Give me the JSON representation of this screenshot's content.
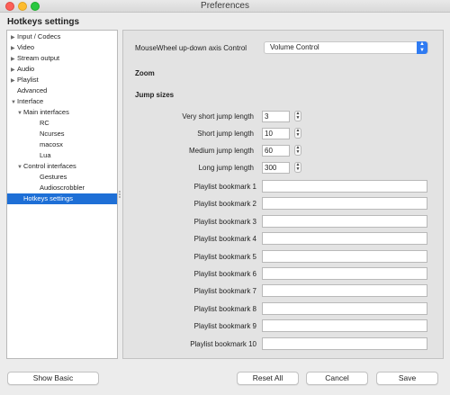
{
  "window": {
    "title": "Preferences"
  },
  "panel_heading": "Hotkeys settings",
  "tree": [
    {
      "label": "Input / Codecs",
      "arrow": "▶",
      "depth": 0,
      "selected": false
    },
    {
      "label": "Video",
      "arrow": "▶",
      "depth": 0,
      "selected": false
    },
    {
      "label": "Stream output",
      "arrow": "▶",
      "depth": 0,
      "selected": false
    },
    {
      "label": "Audio",
      "arrow": "▶",
      "depth": 0,
      "selected": false
    },
    {
      "label": "Playlist",
      "arrow": "▶",
      "depth": 0,
      "selected": false
    },
    {
      "label": "Advanced",
      "arrow": "",
      "depth": 0,
      "selected": false
    },
    {
      "label": "Interface",
      "arrow": "▼",
      "depth": 0,
      "selected": false
    },
    {
      "label": "Main interfaces",
      "arrow": "▼",
      "depth": 1,
      "selected": false
    },
    {
      "label": "RC",
      "arrow": "",
      "depth": 2,
      "selected": false
    },
    {
      "label": "Ncurses",
      "arrow": "",
      "depth": 2,
      "selected": false
    },
    {
      "label": "macosx",
      "arrow": "",
      "depth": 2,
      "selected": false
    },
    {
      "label": "Lua",
      "arrow": "",
      "depth": 2,
      "selected": false
    },
    {
      "label": "Control interfaces",
      "arrow": "▼",
      "depth": 1,
      "selected": false
    },
    {
      "label": "Gestures",
      "arrow": "",
      "depth": 2,
      "selected": false
    },
    {
      "label": "Audioscrobbler",
      "arrow": "",
      "depth": 2,
      "selected": false
    },
    {
      "label": "Hotkeys settings",
      "arrow": "",
      "depth": 1,
      "selected": true
    }
  ],
  "mousewheel": {
    "label": "MouseWheel up-down axis Control",
    "value": "Volume Control"
  },
  "sections": {
    "zoom": "Zoom",
    "jump_sizes": "Jump sizes"
  },
  "jumps": [
    {
      "label": "Very short jump length",
      "value": "3"
    },
    {
      "label": "Short jump length",
      "value": "10"
    },
    {
      "label": "Medium jump length",
      "value": "60"
    },
    {
      "label": "Long jump length",
      "value": "300"
    }
  ],
  "bookmarks": [
    {
      "label": "Playlist bookmark 1",
      "value": ""
    },
    {
      "label": "Playlist bookmark 2",
      "value": ""
    },
    {
      "label": "Playlist bookmark 3",
      "value": ""
    },
    {
      "label": "Playlist bookmark 4",
      "value": ""
    },
    {
      "label": "Playlist bookmark 5",
      "value": ""
    },
    {
      "label": "Playlist bookmark 6",
      "value": ""
    },
    {
      "label": "Playlist bookmark 7",
      "value": ""
    },
    {
      "label": "Playlist bookmark 8",
      "value": ""
    },
    {
      "label": "Playlist bookmark 9",
      "value": ""
    },
    {
      "label": "Playlist bookmark 10",
      "value": ""
    }
  ],
  "buttons": {
    "show_basic": "Show Basic",
    "reset_all": "Reset All",
    "cancel": "Cancel",
    "save": "Save"
  },
  "colors": {
    "selection": "#1e6fd6",
    "dropdown_accent": "#2f7bf2"
  }
}
